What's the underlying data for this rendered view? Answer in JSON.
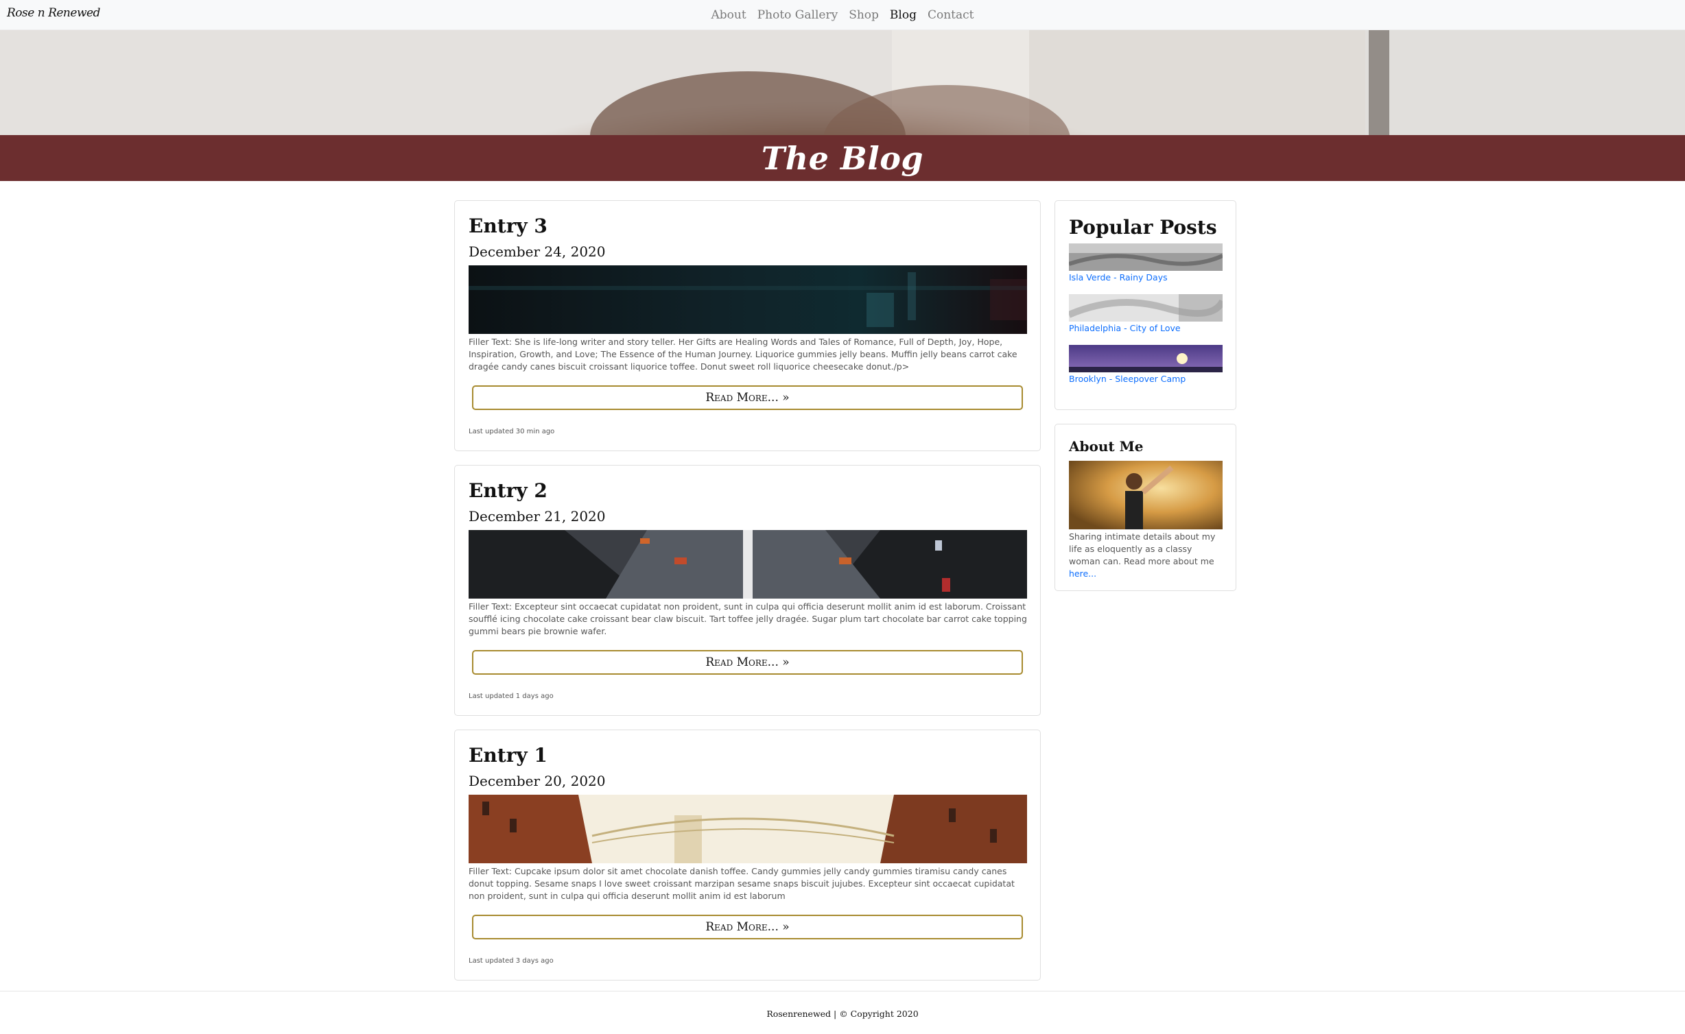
{
  "navbar": {
    "brand": "Rose n Renewed",
    "links": [
      "About",
      "Photo Gallery",
      "Shop",
      "Blog",
      "Contact"
    ]
  },
  "hero": {
    "title": "The Blog"
  },
  "entries": [
    {
      "title": "Entry 3",
      "date": "December 24, 2020",
      "text": "Filler Text: She is life-long writer and story teller. Her Gifts are Healing Words and Tales of Romance, Full of Depth, Joy, Hope, Inspiration, Growth, and Love; The Essence of the Human Journey. Liquorice gummies jelly beans. Muffin jelly beans carrot cake dragée candy canes biscuit croissant liquorice toffee. Donut sweet roll liquorice cheesecake donut./p>",
      "read_more": "Read More... »",
      "updated": "Last updated 30 min ago"
    },
    {
      "title": "Entry 2",
      "date": "December 21, 2020",
      "text": "Filler Text: Excepteur sint occaecat cupidatat non proident, sunt in culpa qui officia deserunt mollit anim id est laborum. Croissant soufflé icing chocolate cake croissant bear claw biscuit. Tart toffee jelly dragée. Sugar plum tart chocolate bar carrot cake topping gummi bears pie brownie wafer.",
      "read_more": "Read More... »",
      "updated": "Last updated 1 days ago"
    },
    {
      "title": "Entry 1",
      "date": "December 20, 2020",
      "text": "Filler Text: Cupcake ipsum dolor sit amet chocolate danish toffee. Candy gummies jelly candy gummies tiramisu candy canes donut topping. Sesame snaps I love sweet croissant marzipan sesame snaps biscuit jujubes. Excepteur sint occaecat cupidatat non proident, sunt in culpa qui officia deserunt mollit anim id est laborum",
      "read_more": "Read More... »",
      "updated": "Last updated 3 days ago"
    }
  ],
  "popular": {
    "title": "Popular Posts",
    "posts": [
      {
        "label": "Isla Verde - Rainy Days"
      },
      {
        "label": "Philadelphia - City of Love"
      },
      {
        "label": "Brooklyn - Sleepover Camp"
      }
    ]
  },
  "about": {
    "title": "About Me",
    "text": "Sharing intimate details about my life as eloquently as a classy woman can. Read more about me ",
    "link": "here..."
  },
  "footer": {
    "text": "Rosenrenewed | © Copyright 2020"
  },
  "colors": {
    "title_band": "#6c2e2f",
    "read_more_border": "#a78a2e",
    "link": "#0d6efd",
    "navbar_bg": "#f8f9fa"
  }
}
